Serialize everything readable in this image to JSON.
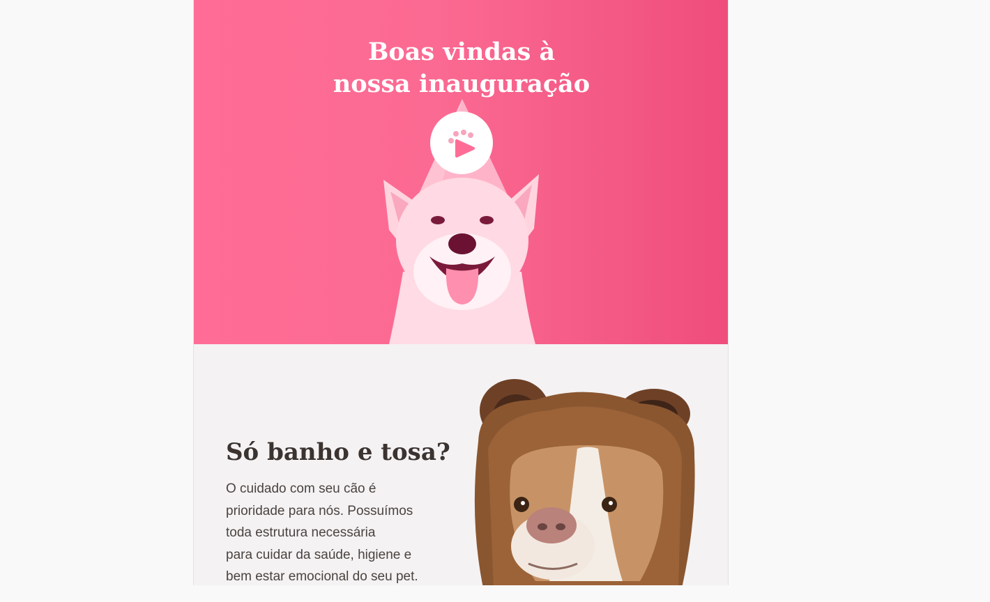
{
  "hero": {
    "title_lines": [
      "Boas vindas à",
      "nossa inauguração"
    ],
    "background_colors": [
      "#ff6d96",
      "#ef4d7c"
    ],
    "play_button_icon": "paw-play-icon",
    "image": "dog-with-party-hat"
  },
  "section": {
    "title": "Só banho e tosa?",
    "body_lines": [
      "O cuidado com seu cão é",
      "prioridade para nós. Possuímos",
      "toda estrutura necessária",
      "para cuidar da saúde, higiene e",
      "bem estar emocional do seu pet."
    ],
    "image": "dog-in-bear-costume"
  }
}
